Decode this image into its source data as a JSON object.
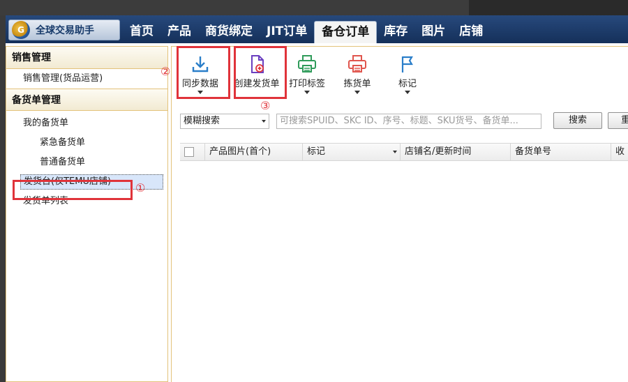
{
  "app": {
    "name": "全球交易助手",
    "logo_letters": "G"
  },
  "menu": [
    {
      "label": "首页",
      "active": false
    },
    {
      "label": "产品",
      "active": false
    },
    {
      "label": "商货绑定",
      "active": false
    },
    {
      "label": "JIT订单",
      "active": false
    },
    {
      "label": "备仓订单",
      "active": true
    },
    {
      "label": "库存",
      "active": false
    },
    {
      "label": "图片",
      "active": false
    },
    {
      "label": "店铺",
      "active": false
    }
  ],
  "sidebar": {
    "group1": "销售管理",
    "group1_item": "销售管理(货品运营)",
    "group2": "备货单管理",
    "items": [
      {
        "label": "我的备货单"
      },
      {
        "label": "紧急备货单"
      },
      {
        "label": "普通备货单"
      },
      {
        "label": "发货台(仅TEMU店铺)"
      },
      {
        "label": "发货单列表"
      }
    ]
  },
  "toolbar": {
    "sync": "同步数据",
    "create": "创建发货单",
    "print": "打印标签",
    "pick": "拣货单",
    "mark": "标记"
  },
  "search": {
    "mode": "模糊搜索",
    "placeholder": "可搜索SPUID、SKC ID、序号、标题、SKU货号、备货单...",
    "search_button": "搜索",
    "reset_button": "重"
  },
  "grid": {
    "columns": [
      "产品图片(首个)",
      "标记",
      "店铺名/更新时间",
      "备货单号",
      "收"
    ]
  },
  "annotations": {
    "one": "①",
    "two": "②",
    "three": "③"
  },
  "colors": {
    "highlight_red": "#e0333a",
    "menubar": "#1f3d6b",
    "accent_border": "#e3c27a"
  }
}
